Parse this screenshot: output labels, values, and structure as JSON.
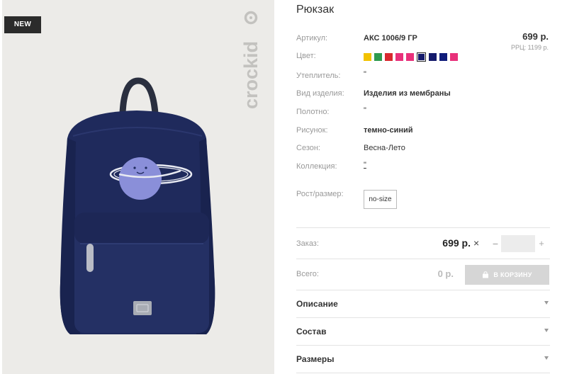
{
  "image_panel": {
    "badge": "NEW",
    "brand_logo_text": "crockid"
  },
  "product": {
    "title": "Рюкзак",
    "price": "699 р.",
    "rrp": "РРЦ: 1199 р."
  },
  "attributes": {
    "sku": {
      "label": "Артикул:",
      "value": "АКС 1006/9 ГР"
    },
    "color": {
      "label": "Цвет:"
    },
    "insulation": {
      "label": "Утеплитель:",
      "value": "\""
    },
    "item_type": {
      "label": "Вид изделия:",
      "value": "Изделия из мембраны"
    },
    "fabric": {
      "label": "Полотно:",
      "value": "\""
    },
    "pattern": {
      "label": "Рисунок:",
      "value": "темно-синий"
    },
    "season": {
      "label": "Сезон:",
      "value": "Весна-Лето"
    },
    "collection": {
      "label": "Коллекция:",
      "value": "\""
    },
    "size": {
      "label": "Рост/размер:",
      "value": "no-size"
    }
  },
  "swatches": [
    {
      "color": "#f2c200",
      "selected": false
    },
    {
      "color": "#2e9a4f",
      "selected": false
    },
    {
      "color": "#d8282f",
      "selected": false
    },
    {
      "color": "#e8307a",
      "selected": false
    },
    {
      "color": "#e8307a",
      "selected": false
    },
    {
      "color": "#141a6b",
      "selected": true
    },
    {
      "color": "#141a6b",
      "selected": false
    },
    {
      "color": "#101c7a",
      "selected": false
    },
    {
      "color": "#e8307a",
      "selected": false
    }
  ],
  "order": {
    "label": "Заказ:",
    "price": "699 р.",
    "multiply": "×",
    "minus": "−",
    "plus": "+",
    "quantity": ""
  },
  "total": {
    "label": "Всего:",
    "value": "0 р.",
    "cart_button": "В КОРЗИНУ"
  },
  "accordion": [
    {
      "label": "Описание"
    },
    {
      "label": "Состав"
    },
    {
      "label": "Размеры"
    }
  ],
  "colors": {
    "navy_backpack": "#1f2a5c",
    "planet": "#8a8fd9",
    "cart_button_disabled": "#d6d6d6",
    "badge_bg": "#2b2b2b"
  }
}
